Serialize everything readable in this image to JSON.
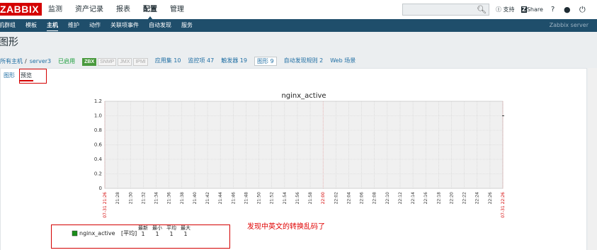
{
  "logo": "ZABBIX",
  "main_menu": [
    "监测",
    "资产记录",
    "报表",
    "配置",
    "管理"
  ],
  "main_menu_active": 3,
  "top_right": {
    "support": "支持",
    "share": "Share",
    "help": "?"
  },
  "sub_menu": [
    "主机群组",
    "模板",
    "主机",
    "维护",
    "动作",
    "关联项事件",
    "自动发现",
    "服务"
  ],
  "sub_menu_active": 2,
  "server_label": "Zabbix server",
  "page_title": "图形",
  "breadcrumb": {
    "all_hosts": "所有主机",
    "separator": "/",
    "host": "server3",
    "enabled": "已启用"
  },
  "availability_badges": [
    "ZBX",
    "SNMP",
    "JMX",
    "IPMI"
  ],
  "host_links": [
    {
      "label": "应用集",
      "count": "10"
    },
    {
      "label": "监控项",
      "count": "47"
    },
    {
      "label": "触发器",
      "count": "19"
    },
    {
      "label": "图形",
      "count": "9"
    },
    {
      "label": "自动发现规则",
      "count": "2"
    },
    {
      "label": "Web 场景",
      "count": ""
    }
  ],
  "current_link": 3,
  "tabs": [
    "图形",
    "预览"
  ],
  "selected_tab": 1,
  "annotation": "发现中英文的转换乱码了",
  "colors": {
    "accent_red": "#d40000",
    "nav_blue": "#1f4e6b",
    "series": "#1a8f1a",
    "grid": "#c8c8c8"
  },
  "chart_data": {
    "type": "line",
    "title": "nginx_active",
    "ylim": [
      0,
      1.2
    ],
    "yticks": [
      "0",
      "0.2",
      "0.4",
      "0.6",
      "0.8",
      "1.0",
      "1.2"
    ],
    "xticks": [
      {
        "label": "07-31 21:26",
        "red": true
      },
      {
        "label": "21:28"
      },
      {
        "label": "21:30"
      },
      {
        "label": "21:32"
      },
      {
        "label": "21:34"
      },
      {
        "label": "21:36"
      },
      {
        "label": "21:38"
      },
      {
        "label": "21:40"
      },
      {
        "label": "21:42"
      },
      {
        "label": "21:44"
      },
      {
        "label": "21:46"
      },
      {
        "label": "21:48"
      },
      {
        "label": "21:50"
      },
      {
        "label": "21:52"
      },
      {
        "label": "21:54"
      },
      {
        "label": "21:56"
      },
      {
        "label": "21:58"
      },
      {
        "label": "22:00",
        "red": true
      },
      {
        "label": "22:02"
      },
      {
        "label": "22:04"
      },
      {
        "label": "22:06"
      },
      {
        "label": "22:08"
      },
      {
        "label": "22:10"
      },
      {
        "label": "22:12"
      },
      {
        "label": "22:14"
      },
      {
        "label": "22:16"
      },
      {
        "label": "22:18"
      },
      {
        "label": "22:20"
      },
      {
        "label": "22:22"
      },
      {
        "label": "22:24"
      },
      {
        "label": "22:26"
      },
      {
        "label": "07-31 22:26",
        "red": true
      }
    ],
    "series": [
      {
        "name": "nginx_active",
        "values": [
          1
        ]
      }
    ],
    "legend": {
      "func_label": "[平均]",
      "headers": [
        "最新",
        "最小",
        "平均",
        "最大"
      ],
      "values": [
        "1",
        "1",
        "1",
        "1"
      ]
    }
  }
}
